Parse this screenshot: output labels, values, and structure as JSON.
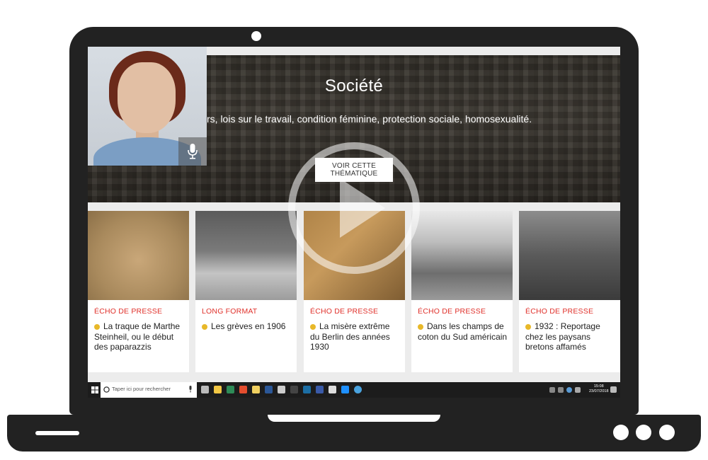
{
  "banner": {
    "title": "Société",
    "subtitle": "rs, lois sur le travail, condition féminine, protection sociale, homosexualité.",
    "button_label": "VOIR CETTE THÉMATIQUE"
  },
  "presenter": {
    "mic_icon": "microphone-icon"
  },
  "cards": [
    {
      "category": "ÉCHO DE PRESSE",
      "title": "La traque de Marthe Steinheil, ou le début des paparazzis"
    },
    {
      "category": "LONG FORMAT",
      "title": "Les grèves en 1906"
    },
    {
      "category": "ÉCHO DE PRESSE",
      "title": "La misère extrême du Berlin des années 1930"
    },
    {
      "category": "ÉCHO DE PRESSE",
      "title": "Dans les champs de coton du Sud américain"
    },
    {
      "category": "ÉCHO DE PRESSE",
      "title": "1932 : Reportage chez les paysans bretons affamés"
    }
  ],
  "taskbar": {
    "search_placeholder": "Taper ici pour rechercher",
    "time": "15:08",
    "date": "23/07/2018"
  },
  "colors": {
    "category_red": "#e0312b",
    "bullet_yellow": "#e8b829",
    "laptop_frame": "#222222"
  }
}
